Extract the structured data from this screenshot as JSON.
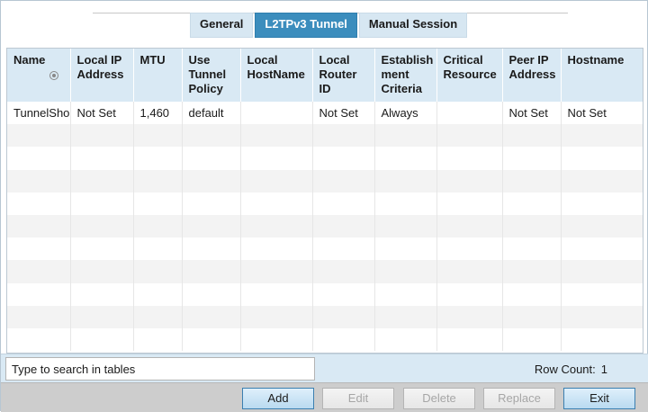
{
  "tabs": [
    {
      "label": "General",
      "active": false
    },
    {
      "label": "L2TPv3 Tunnel",
      "active": true
    },
    {
      "label": "Manual Session",
      "active": false
    }
  ],
  "table": {
    "columns": [
      {
        "key": "name",
        "label": "Name",
        "sortable": true
      },
      {
        "key": "local_ip",
        "label": "Local IP Address"
      },
      {
        "key": "mtu",
        "label": "MTU"
      },
      {
        "key": "use_tunnel_policy",
        "label": "Use Tunnel Policy"
      },
      {
        "key": "local_hostname",
        "label": "Local HostName"
      },
      {
        "key": "local_router_id",
        "label": "Local Router ID"
      },
      {
        "key": "establishment_criteria",
        "label": "Establishment Criteria"
      },
      {
        "key": "critical_resource",
        "label": "Critical Resource"
      },
      {
        "key": "peer_ip",
        "label": "Peer IP Address"
      },
      {
        "key": "hostname",
        "label": "Hostname"
      }
    ],
    "header_lines": {
      "name": [
        "Name"
      ],
      "local_ip": [
        "Local IP",
        "Address"
      ],
      "mtu": [
        "MTU"
      ],
      "use_tunnel_policy": [
        "Use",
        "Tunnel",
        "Policy"
      ],
      "local_hostname": [
        "Local",
        "HostName"
      ],
      "local_router_id": [
        "Local",
        "Router",
        "ID"
      ],
      "establishment_criteria": [
        "Establish",
        "ment",
        "Criteria"
      ],
      "critical_resource": [
        "Critical",
        "Resource"
      ],
      "peer_ip": [
        "Peer IP",
        "Address"
      ],
      "hostname": [
        "Hostname"
      ]
    },
    "rows": [
      [
        "TunnelSho",
        "Not Set",
        "1,460",
        "default",
        "",
        "Not Set",
        "Always",
        "",
        "Not Set",
        "Not Set"
      ]
    ],
    "empty_rows": 10
  },
  "search": {
    "placeholder": "Type to search in tables",
    "value": "Type to search in tables"
  },
  "row_count": {
    "label": "Row Count:",
    "value": "1"
  },
  "buttons": {
    "add": {
      "label": "Add",
      "enabled": true
    },
    "edit": {
      "label": "Edit",
      "enabled": false
    },
    "delete": {
      "label": "Delete",
      "enabled": false
    },
    "replace": {
      "label": "Replace",
      "enabled": false
    },
    "exit": {
      "label": "Exit",
      "enabled": true
    }
  }
}
